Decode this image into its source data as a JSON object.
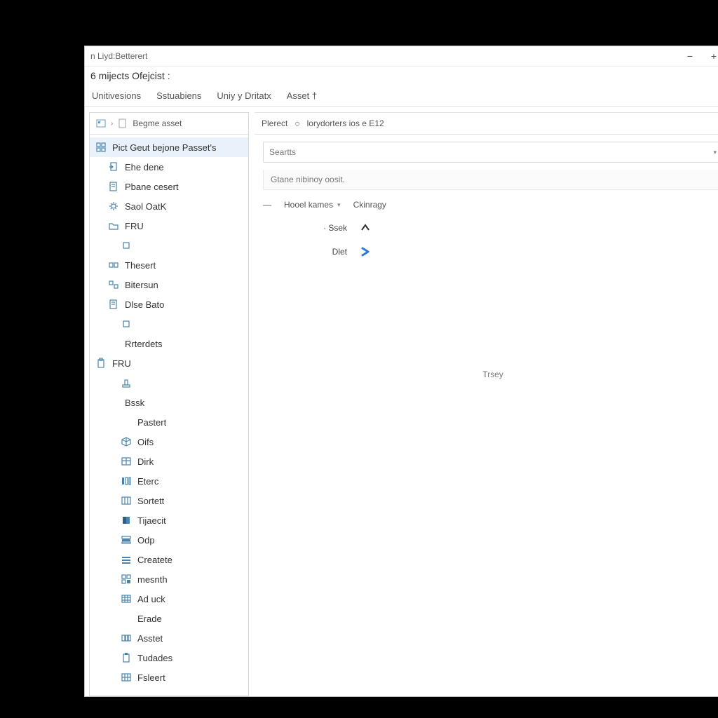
{
  "window": {
    "title": "n Liyd:Betterert"
  },
  "subtitle": "6 mijects Ofejcist :",
  "tabs": [
    "Unitivesions",
    "Sstuabiens",
    "Uniy y Dritatx",
    "Asset †"
  ],
  "winbuttons": {
    "min": "−",
    "plus": "+"
  },
  "sidebar": {
    "header": {
      "chev": "›",
      "label": "Begme asset"
    },
    "nodes": [
      {
        "label": "Pict Geut bejone Passet's",
        "icon": "grid",
        "indent": 0,
        "sel": true
      },
      {
        "label": "Ehe dene",
        "icon": "page-arrow",
        "indent": 1
      },
      {
        "label": "Pbane cesert",
        "icon": "page",
        "indent": 1
      },
      {
        "label": "Saol OatK",
        "icon": "gear",
        "indent": 1
      },
      {
        "label": "FRU",
        "icon": "folder",
        "indent": 1
      },
      {
        "label": "",
        "icon": "square",
        "indent": 2
      },
      {
        "label": "Thesert",
        "icon": "boxes",
        "indent": 1
      },
      {
        "label": "Bitersun",
        "icon": "boxes-alt",
        "indent": 1
      },
      {
        "label": "Dlse Bato",
        "icon": "page",
        "indent": 1
      },
      {
        "label": "",
        "icon": "square",
        "indent": 2
      },
      {
        "label": "Rrterdets",
        "icon": "none",
        "indent": 1
      },
      {
        "label": "FRU",
        "icon": "clipboard",
        "indent": 0
      },
      {
        "label": "",
        "icon": "stamp",
        "indent": 2
      },
      {
        "label": "Bssk",
        "icon": "none",
        "indent": 1
      },
      {
        "label": "Pastert",
        "icon": "none",
        "indent": 2
      },
      {
        "label": "Oifs",
        "icon": "cube",
        "indent": 2
      },
      {
        "label": "Dirk",
        "icon": "table",
        "indent": 2
      },
      {
        "label": "Eterc",
        "icon": "columns",
        "indent": 2
      },
      {
        "label": "Sortett",
        "icon": "grid3",
        "indent": 2
      },
      {
        "label": "Tijaecit",
        "icon": "book",
        "indent": 2
      },
      {
        "label": "Odp",
        "icon": "rows",
        "indent": 2
      },
      {
        "label": "Createte",
        "icon": "lines",
        "indent": 2
      },
      {
        "label": "mesnth",
        "icon": "grid4",
        "indent": 2
      },
      {
        "label": "Ad uck",
        "icon": "table2",
        "indent": 2
      },
      {
        "label": "Erade",
        "icon": "none",
        "indent": 2
      },
      {
        "label": "Asstet",
        "icon": "grid5",
        "indent": 2
      },
      {
        "label": "Tudades",
        "icon": "clipboard2",
        "indent": 2
      },
      {
        "label": "Fsleert",
        "icon": "grid6",
        "indent": 2
      }
    ]
  },
  "breadcrumb": {
    "a": "Plerect",
    "sep": "○",
    "b": "lorydorters ios e E12"
  },
  "search": {
    "placeholder": "Seartts",
    "caret": "▾"
  },
  "info": "Gtane nibinoy oosit.",
  "options": {
    "dash": "—",
    "a": "Hooel kames",
    "ac": "▾",
    "b": "Ckinragy"
  },
  "items": [
    {
      "label": "· Ssek",
      "icon": "arrow-up"
    },
    {
      "label": "Dlet",
      "icon": "arrow-right-blue"
    }
  ],
  "empty": "Trsey"
}
